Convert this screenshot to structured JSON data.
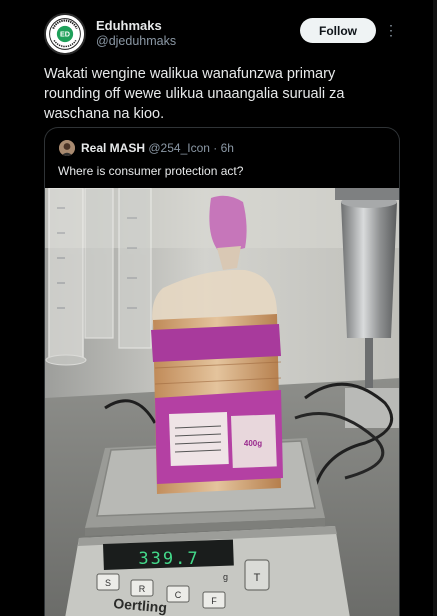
{
  "post": {
    "author": {
      "display_name": "Eduhmaks",
      "handle": "@djeduhmaks",
      "avatar_icon": "eduhmaks-logo-icon"
    },
    "follow_label": "Follow",
    "more_icon": "more-options-icon",
    "text": "Wakati wengine walikua wanafunzwa primary rounding off wewe ulikua unaangalia suruali za waschana na kioo."
  },
  "quote": {
    "author": {
      "display_name": "Real MASH",
      "handle": "@254_Icon",
      "time": "· 6h"
    },
    "text": "Where is consumer protection act?",
    "photo": {
      "scale_reading": "339.7",
      "scale_unit": "g",
      "scale_brand": "Oertling",
      "buttons": [
        "S",
        "R",
        "C",
        "F",
        "T"
      ],
      "bread_label_weight": "400g"
    }
  },
  "colors": {
    "background": "#000000",
    "text": "#e7e9ea",
    "secondary_text": "#8b98a5",
    "follow_bg": "#eff3f4",
    "border": "#2f3336"
  }
}
